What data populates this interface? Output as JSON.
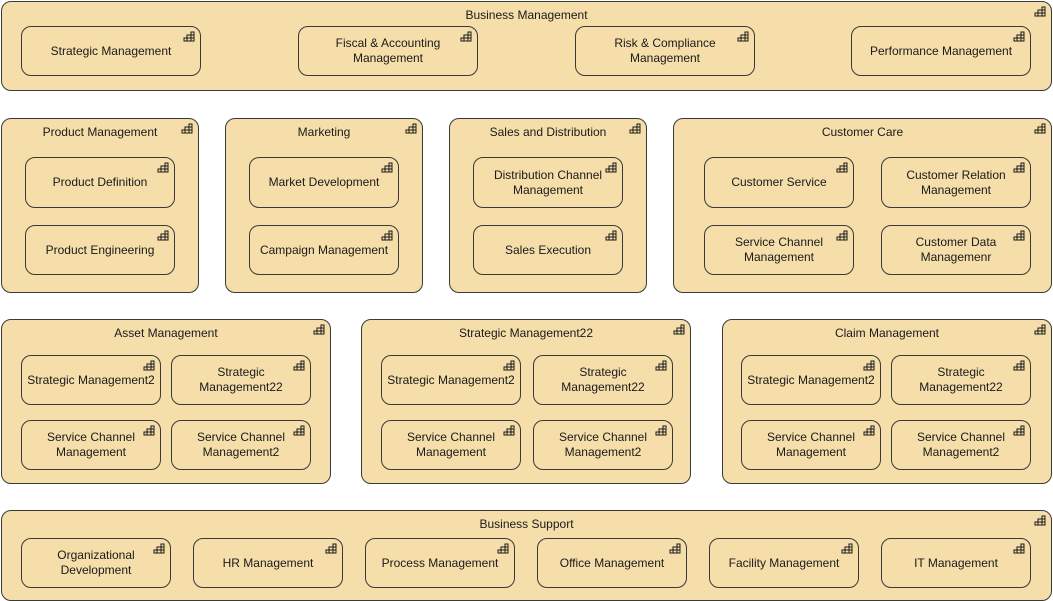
{
  "diagram": {
    "type": "business-capability-map",
    "icon": "capability-icon",
    "colors": {
      "fill": "#f5deaa",
      "stroke": "#3a3a3a",
      "text": "#1a1a1a",
      "background": "#ffffff"
    },
    "groups": [
      {
        "title": "Business Management",
        "items": [
          "Strategic Management",
          "Fiscal & Accounting\nManagement",
          "Risk & Compliance\nManagement",
          "Performance Management"
        ]
      },
      {
        "title": "Product Management",
        "items": [
          "Product Definition",
          "Product Engineering"
        ]
      },
      {
        "title": "Marketing",
        "items": [
          "Market Development",
          "Campaign Management"
        ]
      },
      {
        "title": "Sales and Distribution",
        "items": [
          "Distribution Channel\nManagement",
          "Sales Execution"
        ]
      },
      {
        "title": "Customer Care",
        "items": [
          "Customer Service",
          "Customer Relation\nManagement",
          "Service Channel\nManagement",
          "Customer Data\nManagemenr"
        ]
      },
      {
        "title": "Asset Management",
        "items": [
          "Strategic Management2",
          "Strategic Management22",
          "Service Channel\nManagement",
          "Service Channel\nManagement2"
        ]
      },
      {
        "title": "Strategic Management22",
        "items": [
          "Strategic Management2",
          "Strategic Management22",
          "Service Channel\nManagement",
          "Service Channel\nManagement2"
        ]
      },
      {
        "title": "Claim Management",
        "items": [
          "Strategic Management2",
          "Strategic Management22",
          "Service Channel\nManagement",
          "Service Channel\nManagement2"
        ]
      },
      {
        "title": "Business Support",
        "items": [
          "Organizational\nDevelopment",
          "HR Management",
          "Process Management",
          "Office Management",
          "Facility Management",
          "IT Management"
        ]
      }
    ]
  }
}
